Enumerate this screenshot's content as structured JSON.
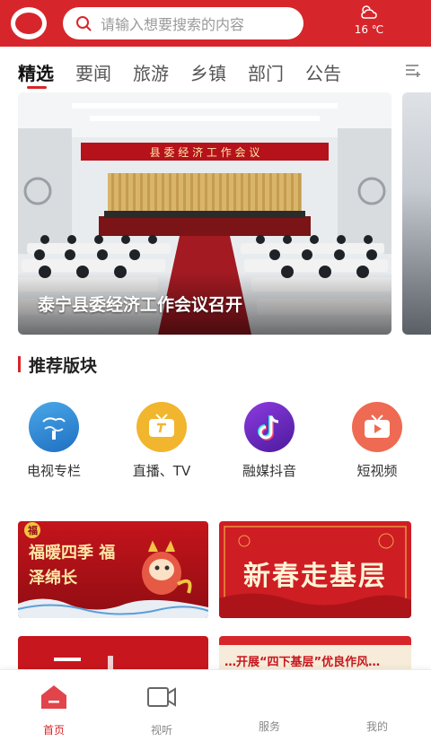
{
  "header": {
    "search_placeholder": "请输入想要搜索的内容",
    "weather_temp": "16 ℃"
  },
  "tabs": [
    "精选",
    "要闻",
    "旅游",
    "乡镇",
    "部门",
    "公告"
  ],
  "banner": {
    "caption": "泰宁县委经济工作会议召开",
    "stage_banner": "县 委 经 济 工 作 会 议"
  },
  "section": {
    "title": "推荐版块"
  },
  "shortcuts": [
    {
      "label": "电视专栏",
      "icon": "tv-column-icon"
    },
    {
      "label": "直播、TV",
      "icon": "live-tv-icon"
    },
    {
      "label": "融媒抖音",
      "icon": "tiktok-icon"
    },
    {
      "label": "短视频",
      "icon": "short-video-icon"
    }
  ],
  "cards": {
    "card1_text": "福暖四季 福泽绵长",
    "card1_mark": "福",
    "card2_text": "新春走基层",
    "card4_text": "…开展“四下基层”优良作风…"
  },
  "bottom_nav": [
    {
      "label": "首页",
      "icon": "home-icon",
      "active": true
    },
    {
      "label": "视听",
      "icon": "video-icon"
    },
    {
      "label": "服务",
      "icon": "service-icon"
    },
    {
      "label": "我的",
      "icon": "profile-icon"
    }
  ],
  "colors": {
    "brand_red": "#d7262b"
  }
}
